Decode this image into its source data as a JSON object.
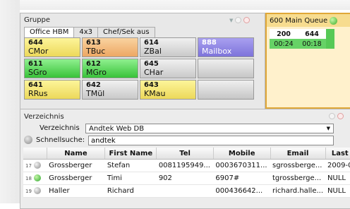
{
  "gruppe": {
    "title": "Gruppe",
    "tabs": [
      {
        "label": "Office HBM"
      },
      {
        "label": "4x3"
      },
      {
        "label": "Chef/Sek aus"
      }
    ],
    "cells": [
      {
        "num": "644",
        "name": "CMor",
        "color": "#f2e36e"
      },
      {
        "num": "613",
        "name": "TBuc",
        "color": "#f2b578"
      },
      {
        "num": "614",
        "name": "ZBal",
        "color": "#d6d6d6"
      },
      {
        "num": "888",
        "name": "Mailbox",
        "color": "#8a80e0"
      },
      {
        "num": "611",
        "name": "SGro",
        "color": "#4fcf4f"
      },
      {
        "num": "612",
        "name": "MGro",
        "color": "#4fcf4f"
      },
      {
        "num": "645",
        "name": "CHar",
        "color": "#d6d6d6"
      },
      {
        "num": "",
        "name": "",
        "color": "#d2d2d2"
      },
      {
        "num": "641",
        "name": "RRus",
        "color": "#f2e36e"
      },
      {
        "num": "642",
        "name": "TMül",
        "color": "#d6d6d6"
      },
      {
        "num": "643",
        "name": "KMau",
        "color": "#f2e36e"
      },
      {
        "num": "",
        "name": "",
        "color": "#d2d2d2"
      }
    ]
  },
  "queue": {
    "title": "600 Main Queue",
    "cols": [
      "200",
      "644"
    ],
    "times": [
      "00:24",
      "00:18"
    ]
  },
  "verzeichnis": {
    "title": "Verzeichnis",
    "dir_label": "Verzeichnis",
    "dir_value": "Andtek Web DB",
    "search_label": "Schnellsuche:",
    "search_value": "andtek",
    "columns": [
      "Name",
      "First Name",
      "Tel",
      "Mobile",
      "Email",
      "Last"
    ],
    "rows": [
      {
        "n": "17",
        "status": "gray",
        "name": "Grossberger",
        "first": "Stefan",
        "tel": "0081195949...",
        "mobile": "0003670311...",
        "email": "sgrossberge...",
        "last": "2009-0"
      },
      {
        "n": "18",
        "status": "green",
        "name": "Grossberger",
        "first": "Timi",
        "tel": "902",
        "mobile": "6907#",
        "email": "tgrossberge...",
        "last": "NULL"
      },
      {
        "n": "19",
        "status": "gray",
        "name": "Haller",
        "first": "Richard",
        "tel": "",
        "mobile": "000436642...",
        "email": "richard.halle...",
        "last": "NULL"
      }
    ]
  }
}
